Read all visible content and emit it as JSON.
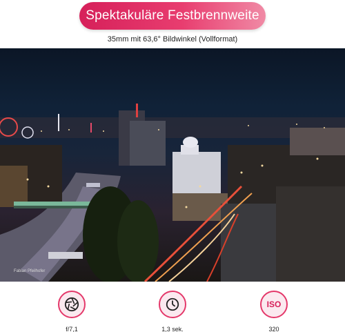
{
  "header": {
    "title": "Spektakuläre Festbrennweite",
    "subtitle": "35mm mit 63,6° Bildwinkel (Vollformat)"
  },
  "photo": {
    "credit": "Fabian Pfeilhofer"
  },
  "stats": [
    {
      "icon": "aperture-icon",
      "value": "f/7,1"
    },
    {
      "icon": "clock-icon",
      "value": "1,3 sek."
    },
    {
      "icon": "iso-icon",
      "label": "ISO",
      "value": "320"
    }
  ],
  "colors": {
    "accent": "#e4386a",
    "accent_dark": "#d6205a",
    "accent_light": "#fbe9ef"
  }
}
